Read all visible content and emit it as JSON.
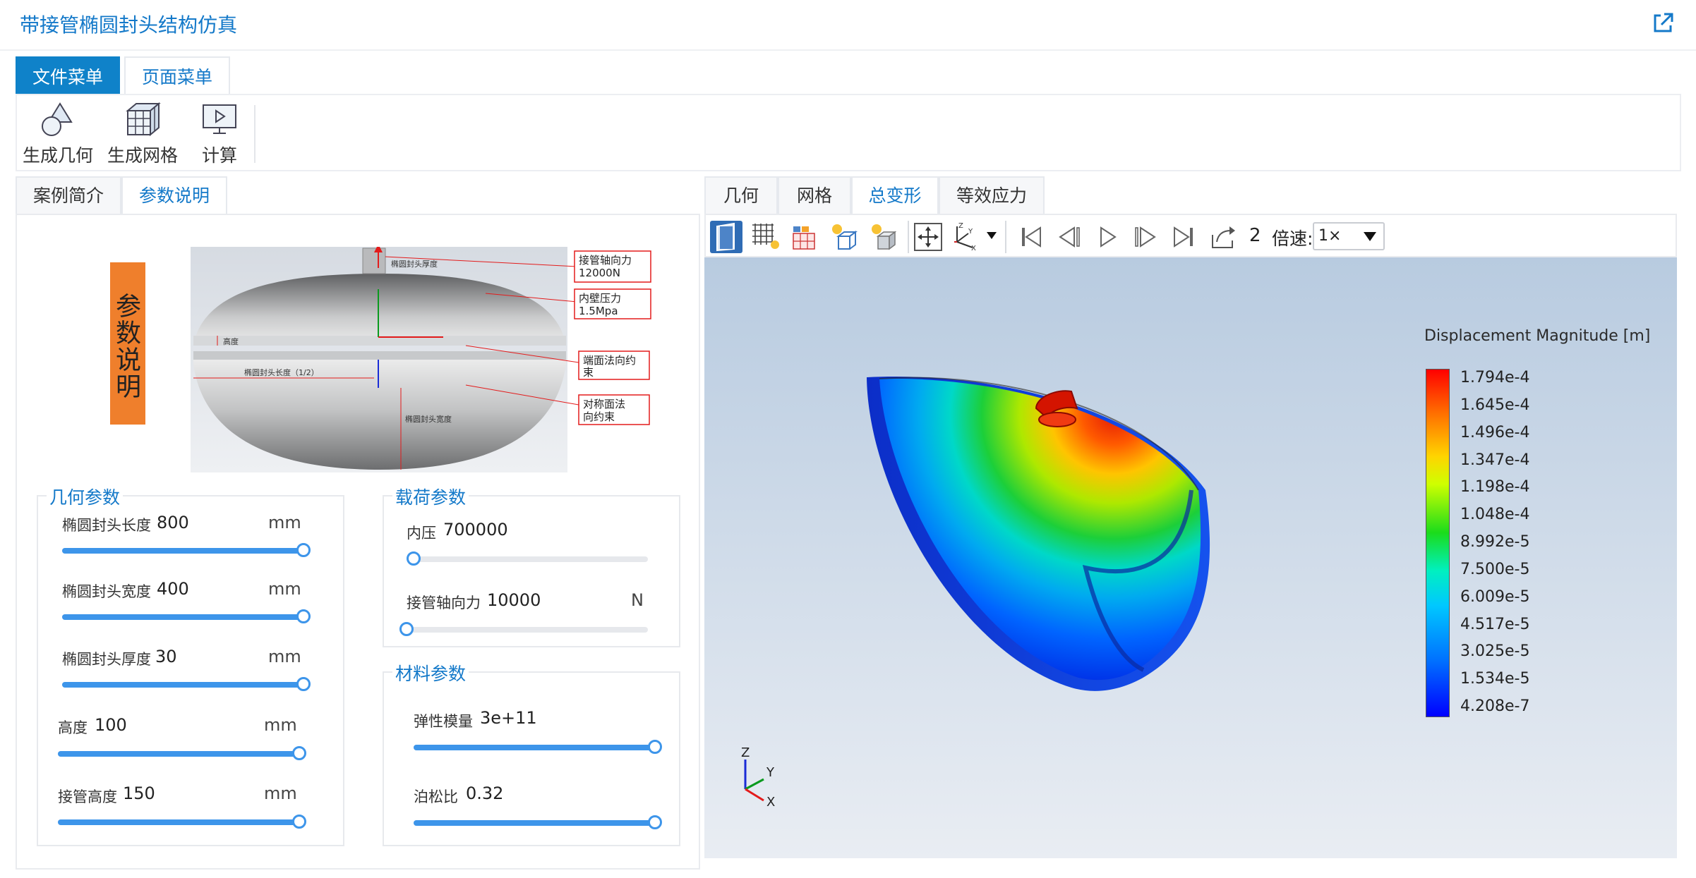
{
  "app": {
    "title": "带接管椭圆封头结构仿真"
  },
  "menu_tabs": [
    {
      "label": "文件菜单"
    },
    {
      "label": "页面菜单"
    }
  ],
  "ribbon": [
    {
      "label": "生成几何"
    },
    {
      "label": "生成网格"
    },
    {
      "label": "计算"
    }
  ],
  "left_tabs": [
    {
      "label": "案例简介"
    },
    {
      "label": "参数说明"
    }
  ],
  "param_note": "参数说明",
  "diagram": {
    "labels": [
      "椭圆封头厚度",
      "高度",
      "椭圆封头长度（1/2）",
      "椭圆封头宽度"
    ],
    "callouts": [
      {
        "line1": "接管轴向力",
        "line2": "12000N"
      },
      {
        "line1": "内壁压力",
        "line2": "1.5Mpa"
      },
      {
        "line1": "端面法向约",
        "line2": "束"
      },
      {
        "line1": "对称面法",
        "line2": "向约束"
      }
    ]
  },
  "geometry_group": {
    "title": "几何参数",
    "params": [
      {
        "name": "椭圆封头长度",
        "value": "800",
        "unit": "mm",
        "fraction": 1.0
      },
      {
        "name": "椭圆封头宽度",
        "value": "400",
        "unit": "mm",
        "fraction": 1.0
      },
      {
        "name": "椭圆封头厚度",
        "value": "30",
        "unit": "mm",
        "fraction": 1.0
      },
      {
        "name": "高度",
        "value": "100",
        "unit": "mm",
        "fraction": 1.0
      },
      {
        "name": "接管高度",
        "value": "150",
        "unit": "mm",
        "fraction": 1.0
      }
    ]
  },
  "load_group": {
    "title": "载荷参数",
    "params": [
      {
        "name": "内压",
        "value": "700000",
        "unit": "",
        "fraction": 0.0
      },
      {
        "name": "接管轴向力",
        "value": "10000",
        "unit": "N",
        "fraction": 0.0
      }
    ]
  },
  "material_group": {
    "title": "材料参数",
    "params": [
      {
        "name": "弹性模量",
        "value": "3e+11",
        "unit": "",
        "fraction": 1.0
      },
      {
        "name": "泊松比",
        "value": "0.32",
        "unit": "",
        "fraction": 1.0
      }
    ]
  },
  "viewer_tabs": [
    {
      "label": "几何"
    },
    {
      "label": "网格"
    },
    {
      "label": "总变形"
    },
    {
      "label": "等效应力"
    }
  ],
  "viewer_active_tab": "总变形",
  "toolbar": {
    "frame": "2",
    "speed_label": "倍速:",
    "speed_value": "1×"
  },
  "legend": {
    "title": "Displacement Magnitude [m]",
    "ticks": [
      "1.794e-4",
      "1.645e-4",
      "1.496e-4",
      "1.347e-4",
      "1.198e-4",
      "1.048e-4",
      "8.992e-5",
      "7.500e-5",
      "6.009e-5",
      "4.517e-5",
      "3.025e-5",
      "1.534e-5",
      "4.208e-7"
    ]
  },
  "triad": {
    "x": "X",
    "y": "Y",
    "z": "Z"
  },
  "colors": {
    "accent": "#0f82c9",
    "slider": "#3d95ea",
    "orange_label": "#ef7f2c"
  }
}
